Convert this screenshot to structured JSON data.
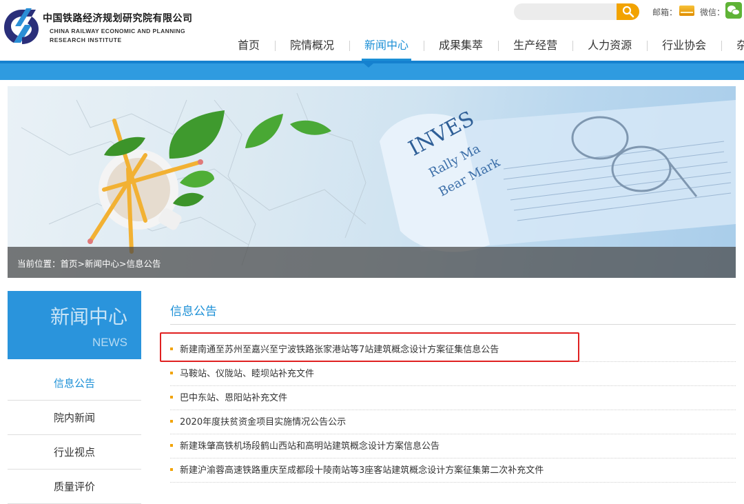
{
  "header": {
    "org_name_cn": "中国铁路经济规划研究院有限公司",
    "org_name_en_line1": "CHINA RAILWAY ECONOMIC AND PLANNING",
    "org_name_en_line2": "RESEARCH INSTITUTE",
    "search_placeholder": "",
    "mail_label": "邮箱：",
    "wechat_label": "微信："
  },
  "nav": {
    "items": [
      {
        "label": "首页"
      },
      {
        "label": "院情概况"
      },
      {
        "label": "新闻中心"
      },
      {
        "label": "成果集萃"
      },
      {
        "label": "生产经营"
      },
      {
        "label": "人力资源"
      },
      {
        "label": "行业协会"
      },
      {
        "label": "杂志刊物"
      }
    ],
    "active": "新闻中心"
  },
  "banner": {
    "breadcrumb_prefix": "当前位置：",
    "breadcrumb": [
      "首页",
      "新闻中心",
      "信息公告"
    ],
    "breadcrumb_sep": ">"
  },
  "sidebar": {
    "title": "新闻中心",
    "title_en": "NEWS",
    "items": [
      {
        "label": "信息公告"
      },
      {
        "label": "院内新闻"
      },
      {
        "label": "行业视点"
      },
      {
        "label": "质量评价"
      }
    ]
  },
  "content": {
    "title": "信息公告",
    "news": [
      {
        "title": "新建南通至苏州至嘉兴至宁波铁路张家港站等7站建筑概念设计方案征集信息公告"
      },
      {
        "title": "马鞍站、仪陇站、睦坝站补充文件"
      },
      {
        "title": "巴中东站、恩阳站补充文件"
      },
      {
        "title": "2020年度扶贫资金项目实施情况公告公示"
      },
      {
        "title": "新建珠肇高铁机场段鹤山西站和高明站建筑概念设计方案信息公告"
      },
      {
        "title": "新建沪渝蓉高速铁路重庆至成都段十陵南站等3座客站建筑概念设计方案征集第二次补充文件"
      }
    ]
  },
  "colors": {
    "brand_blue": "#1b8fd6",
    "accent_orange": "#f2a300",
    "highlight_red": "#e02020"
  }
}
